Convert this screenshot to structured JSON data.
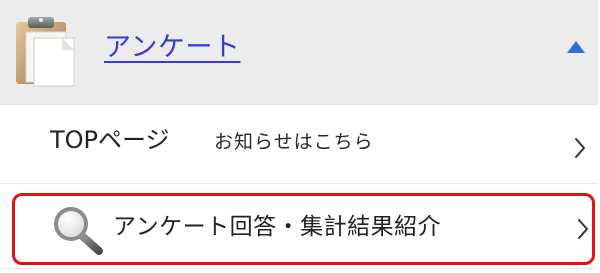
{
  "header": {
    "title": "アンケート",
    "icon": "clipboard-icon",
    "toggle_icon": "caret-up-icon",
    "link_color": "#3a3ad6"
  },
  "items": [
    {
      "title": "TOPページ",
      "subtitle": "お知らせはこちら",
      "chevron_icon": "chevron-right-icon"
    },
    {
      "icon": "magnifier-icon",
      "title": "アンケート回答・集計結果紹介",
      "chevron_icon": "chevron-right-icon",
      "highlight_color": "#e11414"
    }
  ]
}
